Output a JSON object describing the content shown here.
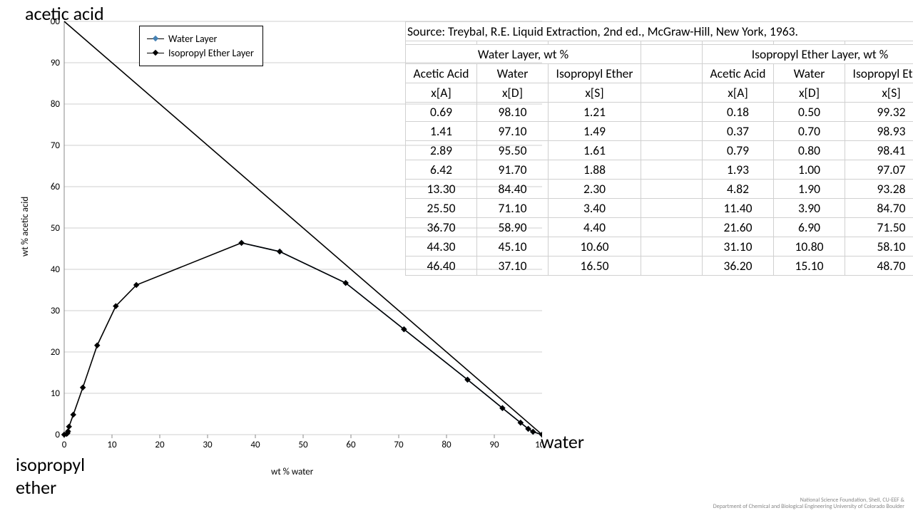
{
  "vertices": {
    "top": "acetic acid",
    "left": "isopropyl\nether",
    "right": "water"
  },
  "chart_data": {
    "type": "line",
    "title": "",
    "xlabel": "wt % water",
    "ylabel": "wt % acetic acid",
    "xlim": [
      0,
      100
    ],
    "ylim": [
      0,
      100
    ],
    "xticks": [
      0,
      10,
      20,
      30,
      40,
      50,
      60,
      70,
      80,
      90,
      100
    ],
    "yticks": [
      0,
      10,
      20,
      30,
      40,
      50,
      60,
      70,
      80,
      90,
      100
    ],
    "series": [
      {
        "name": "Water Layer",
        "color": "#4a7ebb",
        "marker": "diamond",
        "x": [
          37.1,
          45.1,
          58.9,
          71.1,
          84.4,
          91.7,
          95.5,
          97.1,
          98.1,
          100
        ],
        "y": [
          46.4,
          44.3,
          36.7,
          25.5,
          13.3,
          6.42,
          2.89,
          1.41,
          0.69,
          0
        ]
      },
      {
        "name": "Isopropyl Ether Layer",
        "color": "#000000",
        "marker": "diamond",
        "x": [
          0,
          0.5,
          0.7,
          0.8,
          1.0,
          1.9,
          3.9,
          6.9,
          10.8,
          15.1,
          37.1,
          45.1,
          58.9,
          71.1,
          84.4,
          91.7,
          95.5,
          97.1,
          98.1,
          100
        ],
        "y": [
          0,
          0.18,
          0.37,
          0.79,
          1.93,
          4.82,
          11.4,
          21.6,
          31.1,
          36.2,
          46.4,
          44.3,
          36.7,
          25.5,
          13.3,
          6.42,
          2.89,
          1.41,
          0.69,
          0
        ]
      },
      {
        "name": "diagonal",
        "color": "#000000",
        "marker": "none",
        "legend": false,
        "x": [
          0,
          100
        ],
        "y": [
          100,
          0
        ]
      }
    ]
  },
  "legend": {
    "s1": "Water Layer",
    "s2": "Isopropyl Ether Layer"
  },
  "table": {
    "source": "Source: Treybal, R.E. Liquid Extraction, 2nd ed., McGraw-Hill, New York, 1963.",
    "group1": "Water Layer, wt %",
    "group2": "Isopropyl Ether Layer, wt %",
    "h": [
      "Acetic Acid",
      "Water",
      "Isopropyl Ether",
      "",
      "Acetic Acid",
      "Water",
      "Isopropyl Ether"
    ],
    "s": [
      "x[A]",
      "x[D]",
      "x[S]",
      "",
      "x[A]",
      "x[D]",
      "x[S]"
    ],
    "rows": [
      [
        "0.69",
        "98.10",
        "1.21",
        "",
        "0.18",
        "0.50",
        "99.32"
      ],
      [
        "1.41",
        "97.10",
        "1.49",
        "",
        "0.37",
        "0.70",
        "98.93"
      ],
      [
        "2.89",
        "95.50",
        "1.61",
        "",
        "0.79",
        "0.80",
        "98.41"
      ],
      [
        "6.42",
        "91.70",
        "1.88",
        "",
        "1.93",
        "1.00",
        "97.07"
      ],
      [
        "13.30",
        "84.40",
        "2.30",
        "",
        "4.82",
        "1.90",
        "93.28"
      ],
      [
        "25.50",
        "71.10",
        "3.40",
        "",
        "11.40",
        "3.90",
        "84.70"
      ],
      [
        "36.70",
        "58.90",
        "4.40",
        "",
        "21.60",
        "6.90",
        "71.50"
      ],
      [
        "44.30",
        "45.10",
        "10.60",
        "",
        "31.10",
        "10.80",
        "58.10"
      ],
      [
        "46.40",
        "37.10",
        "16.50",
        "",
        "36.20",
        "15.10",
        "48.70"
      ]
    ]
  },
  "footer": {
    "l1": "National Science Foundation, Shell, CU-EEF &",
    "l2": "Department of Chemical and Biological Engineering     University of Colorado Boulder"
  }
}
